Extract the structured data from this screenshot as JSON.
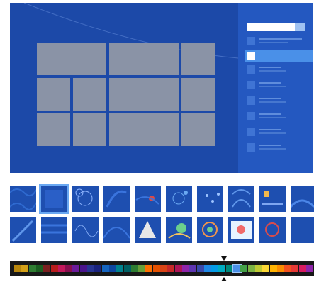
{
  "preview": {
    "background_color": "#1c49a8",
    "tile_color": "#8a93a6",
    "panel_color": "#2458c0",
    "accent_color": "#4a90e8"
  },
  "thumbnails": {
    "count": 20,
    "selected_index": 1,
    "icons": [
      "wave-pattern-icon",
      "solid-blue-icon",
      "swirl-pattern-icon",
      "leaf-pattern-icon",
      "flower-pattern-icon",
      "bubble-pattern-icon",
      "dot-pattern-icon",
      "floral-pattern-icon",
      "sketch-pattern-icon",
      "ribbon-pattern-icon",
      "feather-pattern-icon",
      "stripe-pattern-icon",
      "scribble-pattern-icon",
      "curve-pattern-icon",
      "origami-pattern-icon",
      "tropical-pattern-icon",
      "colorful-swirl-icon",
      "illustration-pattern-icon",
      "circle-pattern-icon",
      "plain-blue-icon"
    ]
  },
  "palette": {
    "selected_index": 30,
    "colors": [
      "#b8860b",
      "#d4a017",
      "#2f7d32",
      "#1b5e20",
      "#7a1f1f",
      "#b71c1c",
      "#c2185b",
      "#880e4f",
      "#6a1b9a",
      "#4a148c",
      "#283593",
      "#1a237e",
      "#1565c0",
      "#0d47a1",
      "#00838f",
      "#006064",
      "#2e7d32",
      "#689f38",
      "#ff6f00",
      "#e65100",
      "#d84315",
      "#c62828",
      "#ad1457",
      "#8e24aa",
      "#5e35b1",
      "#3949ab",
      "#1e88e5",
      "#039be5",
      "#00acc1",
      "#00897b",
      "#4a90e8",
      "#43a047",
      "#7cb342",
      "#c0ca33",
      "#fdd835",
      "#ffb300",
      "#fb8c00",
      "#f4511e",
      "#e53935",
      "#d81b60",
      "#8e24aa"
    ]
  }
}
